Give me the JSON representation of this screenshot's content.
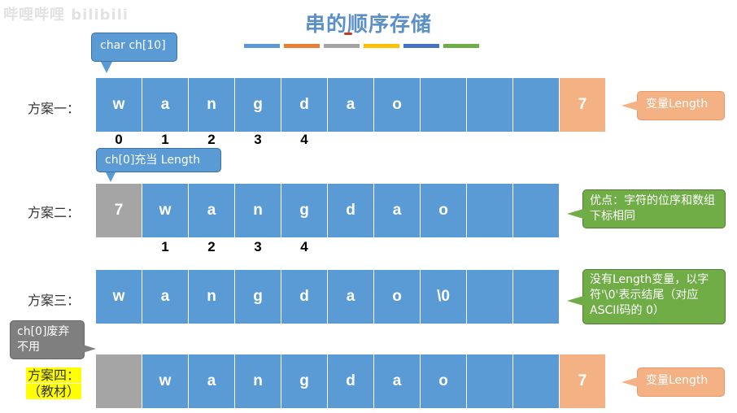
{
  "watermark": "哔哩哔哩 bilibili",
  "title": "串的顺序存储",
  "color_strip": [
    "#5b9bd5",
    "#ed7d31",
    "#a5a5a5",
    "#ffc000",
    "#4472c4",
    "#70ad47"
  ],
  "callouts": {
    "char_array": "char ch[10]",
    "ch0_length": "ch[0]充当 Length",
    "ch0_discard": "ch[0]废弃不用",
    "length_var_1": "变量Length",
    "advantage": "优点：字符的位序和数组下标相同",
    "no_length": "没有Length变量，以字符'\\0'表示结尾（对应ASCII码的 0）",
    "length_var_4": "变量Length"
  },
  "schemes": [
    {
      "label": "方案一：",
      "cells": [
        "w",
        "a",
        "n",
        "g",
        "d",
        "a",
        "o",
        "",
        "",
        "",
        "7"
      ],
      "indices": [
        "0",
        "1",
        "2",
        "3",
        "4"
      ]
    },
    {
      "label": "方案二：",
      "cells": [
        "7",
        "w",
        "a",
        "n",
        "g",
        "d",
        "a",
        "o",
        "",
        ""
      ],
      "indices": [
        "1",
        "2",
        "3",
        "4"
      ]
    },
    {
      "label": "方案三：",
      "cells": [
        "w",
        "a",
        "n",
        "g",
        "d",
        "a",
        "o",
        "\\0",
        "",
        ""
      ]
    },
    {
      "label_line1": "方案四：",
      "label_line2": "（教材）",
      "cells": [
        "",
        "w",
        "a",
        "n",
        "g",
        "d",
        "a",
        "o",
        "",
        "",
        "7"
      ]
    }
  ]
}
